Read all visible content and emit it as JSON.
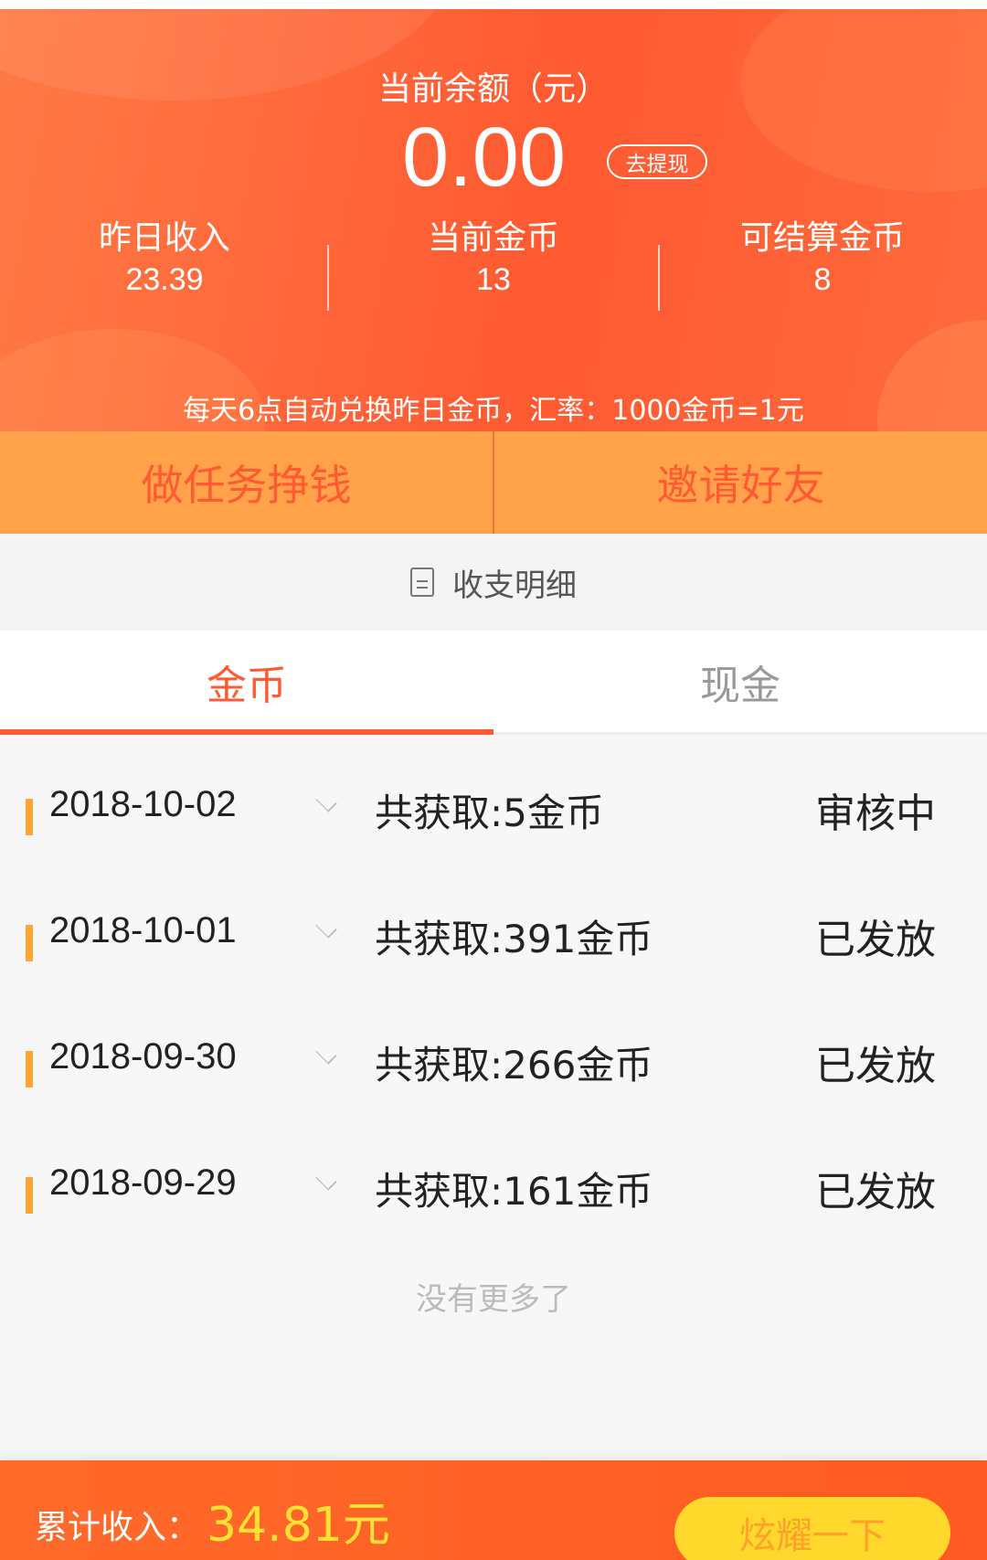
{
  "balance": {
    "title": "当前余额（元）",
    "value": "0.00",
    "withdraw_label": "去提现"
  },
  "stats": [
    {
      "label": "昨日收入",
      "value": "23.39"
    },
    {
      "label": "当前金币",
      "value": "13"
    },
    {
      "label": "可结算金币",
      "value": "8"
    }
  ],
  "rate_note": "每天6点自动兑换昨日金币，汇率：1000金币=1元",
  "actions": {
    "task_label": "做任务挣钱",
    "invite_label": "邀请好友"
  },
  "section": {
    "title": "收支明细",
    "icon": "document-icon"
  },
  "tabs": [
    {
      "label": "金币",
      "active": true
    },
    {
      "label": "现金",
      "active": false
    }
  ],
  "records": [
    {
      "date": "2018-10-02",
      "summary": "共获取:5金币",
      "status": "审核中"
    },
    {
      "date": "2018-10-01",
      "summary": "共获取:391金币",
      "status": "已发放"
    },
    {
      "date": "2018-09-30",
      "summary": "共获取:266金币",
      "status": "已发放"
    },
    {
      "date": "2018-09-29",
      "summary": "共获取:161金币",
      "status": "已发放"
    }
  ],
  "no_more": "没有更多了",
  "footer": {
    "total_label": "累计收入：",
    "total_value": "34.81元",
    "share_label": "炫耀一下"
  },
  "colors": {
    "primary": "#ff5a32",
    "action_bar": "#ffa24a",
    "accent_yellow": "#ffe135",
    "share_button": "#ffd82b"
  }
}
